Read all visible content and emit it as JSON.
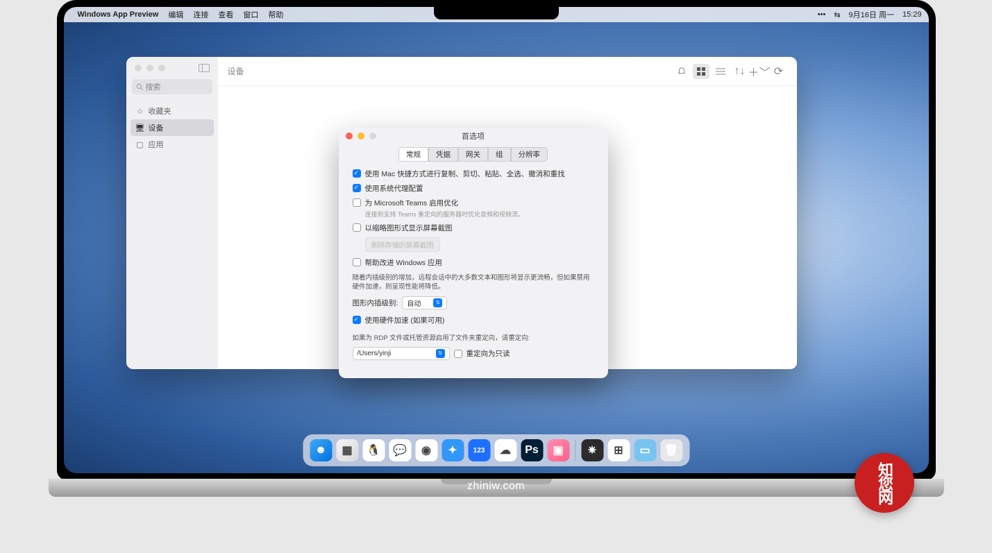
{
  "menubar": {
    "app_name": "Windows App Preview",
    "items": [
      "编辑",
      "连接",
      "查看",
      "窗口",
      "帮助"
    ],
    "date": "9月16日 周一",
    "time": "15:29"
  },
  "app_window": {
    "title": "设备",
    "search_placeholder": "搜索",
    "sidebar": {
      "items": [
        {
          "icon": "star",
          "label": "收藏夹"
        },
        {
          "icon": "display",
          "label": "设备"
        },
        {
          "icon": "app",
          "label": "应用"
        }
      ],
      "selected_index": 1
    }
  },
  "prefs": {
    "title": "首选项",
    "tabs": [
      "常规",
      "凭据",
      "网关",
      "组",
      "分辨率"
    ],
    "active_tab": 0,
    "opt_mac_shortcuts": "使用 Mac 快捷方式进行复制、剪切、粘贴、全选、撤消和重找",
    "opt_system_proxy": "使用系统代理配置",
    "opt_teams": "为 Microsoft Teams 启用优化",
    "opt_teams_sub": "连接到支持 Teams 重定向的服务器时优化音频和视频流。",
    "opt_thumbnail": "以缩略图形式显示屏幕截图",
    "btn_clear_thumbs": "删除存储的屏幕截图",
    "opt_improve": "帮助改进 Windows 应用",
    "interp_desc": "随着内插级别的增加，远程会话中的大多数文本和图形将显示更流畅，但如果禁用硬件加速，则呈现性能将降低。",
    "interp_label": "图形内插级别:",
    "interp_value": "自动",
    "opt_hw_accel": "使用硬件加速 (如果可用)",
    "redirect_desc": "如果为 RDP 文件或托管资源启用了文件夹重定向，请重定向:",
    "redirect_path": "/Users/yinji",
    "opt_readonly": "重定向为只读"
  },
  "dock": {
    "items": [
      {
        "name": "finder",
        "bg": "linear-gradient(135deg,#3fa9f5,#0071e3)",
        "glyph": "☻"
      },
      {
        "name": "launchpad",
        "bg": "linear-gradient(135deg,#f5f5f7,#d8d8da)",
        "glyph": "▦"
      },
      {
        "name": "qq",
        "bg": "#fff",
        "glyph": "🐧"
      },
      {
        "name": "wechat",
        "bg": "#fff",
        "glyph": "💬"
      },
      {
        "name": "chrome",
        "bg": "#fff",
        "glyph": "◉"
      },
      {
        "name": "dingtalk",
        "bg": "#3296fa",
        "glyph": "✦"
      },
      {
        "name": "123",
        "bg": "#1e6fff",
        "glyph": "123"
      },
      {
        "name": "baidu",
        "bg": "#fff",
        "glyph": "☁"
      },
      {
        "name": "photoshop",
        "bg": "#001e36",
        "glyph": "Ps"
      },
      {
        "name": "cleanshot",
        "bg": "linear-gradient(135deg,#ff8fb1,#ff5e8a)",
        "glyph": "▣"
      },
      {
        "name": "sep",
        "sep": true
      },
      {
        "name": "wheel",
        "bg": "#2b2b2b",
        "glyph": "✷"
      },
      {
        "name": "windows",
        "bg": "#fff",
        "glyph": "⊞"
      },
      {
        "name": "folder",
        "bg": "#78c4f0",
        "glyph": "▭"
      },
      {
        "name": "trash",
        "bg": "#e8e8ea",
        "glyph": "🗑"
      }
    ]
  },
  "subtitle": "zhiniw.com",
  "watermark": "知您网"
}
